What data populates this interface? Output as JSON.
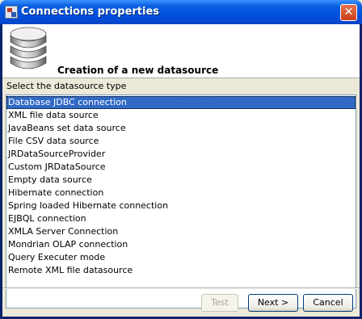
{
  "window": {
    "title": "Connections properties",
    "close_glyph": "✕"
  },
  "header": {
    "heading": "Creation of a new datasource",
    "icon": "database-icon"
  },
  "datasource": {
    "label": "Select the datasource type",
    "selected_index": 0,
    "items": [
      "Database JDBC connection",
      "XML file data source",
      "JavaBeans set data source",
      "File CSV data source",
      "JRDataSourceProvider",
      "Custom JRDataSource",
      "Empty data source",
      "Hibernate connection",
      "Spring loaded Hibernate connection",
      "EJBQL connection",
      "XMLA Server Connection",
      "Mondrian OLAP connection",
      "Query Executer mode",
      "Remote XML file datasource"
    ]
  },
  "buttons": {
    "test": "Test",
    "next": "Next >",
    "cancel": "Cancel"
  },
  "colors": {
    "selection": "#316AC5",
    "titlebar": "#0050DE",
    "dialog_bg": "#ECE9D8"
  }
}
